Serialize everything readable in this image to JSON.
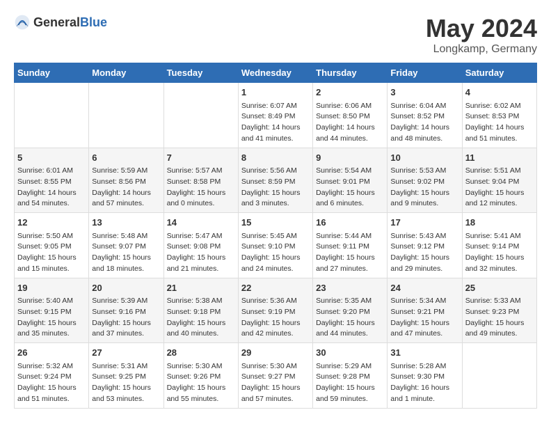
{
  "header": {
    "logo_general": "General",
    "logo_blue": "Blue",
    "title": "May 2024",
    "subtitle": "Longkamp, Germany"
  },
  "days_of_week": [
    "Sunday",
    "Monday",
    "Tuesday",
    "Wednesday",
    "Thursday",
    "Friday",
    "Saturday"
  ],
  "weeks": [
    {
      "cells": [
        {
          "day": "",
          "content": ""
        },
        {
          "day": "",
          "content": ""
        },
        {
          "day": "",
          "content": ""
        },
        {
          "day": "1",
          "content": "Sunrise: 6:07 AM\nSunset: 8:49 PM\nDaylight: 14 hours\nand 41 minutes."
        },
        {
          "day": "2",
          "content": "Sunrise: 6:06 AM\nSunset: 8:50 PM\nDaylight: 14 hours\nand 44 minutes."
        },
        {
          "day": "3",
          "content": "Sunrise: 6:04 AM\nSunset: 8:52 PM\nDaylight: 14 hours\nand 48 minutes."
        },
        {
          "day": "4",
          "content": "Sunrise: 6:02 AM\nSunset: 8:53 PM\nDaylight: 14 hours\nand 51 minutes."
        }
      ]
    },
    {
      "cells": [
        {
          "day": "5",
          "content": "Sunrise: 6:01 AM\nSunset: 8:55 PM\nDaylight: 14 hours\nand 54 minutes."
        },
        {
          "day": "6",
          "content": "Sunrise: 5:59 AM\nSunset: 8:56 PM\nDaylight: 14 hours\nand 57 minutes."
        },
        {
          "day": "7",
          "content": "Sunrise: 5:57 AM\nSunset: 8:58 PM\nDaylight: 15 hours\nand 0 minutes."
        },
        {
          "day": "8",
          "content": "Sunrise: 5:56 AM\nSunset: 8:59 PM\nDaylight: 15 hours\nand 3 minutes."
        },
        {
          "day": "9",
          "content": "Sunrise: 5:54 AM\nSunset: 9:01 PM\nDaylight: 15 hours\nand 6 minutes."
        },
        {
          "day": "10",
          "content": "Sunrise: 5:53 AM\nSunset: 9:02 PM\nDaylight: 15 hours\nand 9 minutes."
        },
        {
          "day": "11",
          "content": "Sunrise: 5:51 AM\nSunset: 9:04 PM\nDaylight: 15 hours\nand 12 minutes."
        }
      ]
    },
    {
      "cells": [
        {
          "day": "12",
          "content": "Sunrise: 5:50 AM\nSunset: 9:05 PM\nDaylight: 15 hours\nand 15 minutes."
        },
        {
          "day": "13",
          "content": "Sunrise: 5:48 AM\nSunset: 9:07 PM\nDaylight: 15 hours\nand 18 minutes."
        },
        {
          "day": "14",
          "content": "Sunrise: 5:47 AM\nSunset: 9:08 PM\nDaylight: 15 hours\nand 21 minutes."
        },
        {
          "day": "15",
          "content": "Sunrise: 5:45 AM\nSunset: 9:10 PM\nDaylight: 15 hours\nand 24 minutes."
        },
        {
          "day": "16",
          "content": "Sunrise: 5:44 AM\nSunset: 9:11 PM\nDaylight: 15 hours\nand 27 minutes."
        },
        {
          "day": "17",
          "content": "Sunrise: 5:43 AM\nSunset: 9:12 PM\nDaylight: 15 hours\nand 29 minutes."
        },
        {
          "day": "18",
          "content": "Sunrise: 5:41 AM\nSunset: 9:14 PM\nDaylight: 15 hours\nand 32 minutes."
        }
      ]
    },
    {
      "cells": [
        {
          "day": "19",
          "content": "Sunrise: 5:40 AM\nSunset: 9:15 PM\nDaylight: 15 hours\nand 35 minutes."
        },
        {
          "day": "20",
          "content": "Sunrise: 5:39 AM\nSunset: 9:16 PM\nDaylight: 15 hours\nand 37 minutes."
        },
        {
          "day": "21",
          "content": "Sunrise: 5:38 AM\nSunset: 9:18 PM\nDaylight: 15 hours\nand 40 minutes."
        },
        {
          "day": "22",
          "content": "Sunrise: 5:36 AM\nSunset: 9:19 PM\nDaylight: 15 hours\nand 42 minutes."
        },
        {
          "day": "23",
          "content": "Sunrise: 5:35 AM\nSunset: 9:20 PM\nDaylight: 15 hours\nand 44 minutes."
        },
        {
          "day": "24",
          "content": "Sunrise: 5:34 AM\nSunset: 9:21 PM\nDaylight: 15 hours\nand 47 minutes."
        },
        {
          "day": "25",
          "content": "Sunrise: 5:33 AM\nSunset: 9:23 PM\nDaylight: 15 hours\nand 49 minutes."
        }
      ]
    },
    {
      "cells": [
        {
          "day": "26",
          "content": "Sunrise: 5:32 AM\nSunset: 9:24 PM\nDaylight: 15 hours\nand 51 minutes."
        },
        {
          "day": "27",
          "content": "Sunrise: 5:31 AM\nSunset: 9:25 PM\nDaylight: 15 hours\nand 53 minutes."
        },
        {
          "day": "28",
          "content": "Sunrise: 5:30 AM\nSunset: 9:26 PM\nDaylight: 15 hours\nand 55 minutes."
        },
        {
          "day": "29",
          "content": "Sunrise: 5:30 AM\nSunset: 9:27 PM\nDaylight: 15 hours\nand 57 minutes."
        },
        {
          "day": "30",
          "content": "Sunrise: 5:29 AM\nSunset: 9:28 PM\nDaylight: 15 hours\nand 59 minutes."
        },
        {
          "day": "31",
          "content": "Sunrise: 5:28 AM\nSunset: 9:30 PM\nDaylight: 16 hours\nand 1 minute."
        },
        {
          "day": "",
          "content": ""
        }
      ]
    }
  ]
}
